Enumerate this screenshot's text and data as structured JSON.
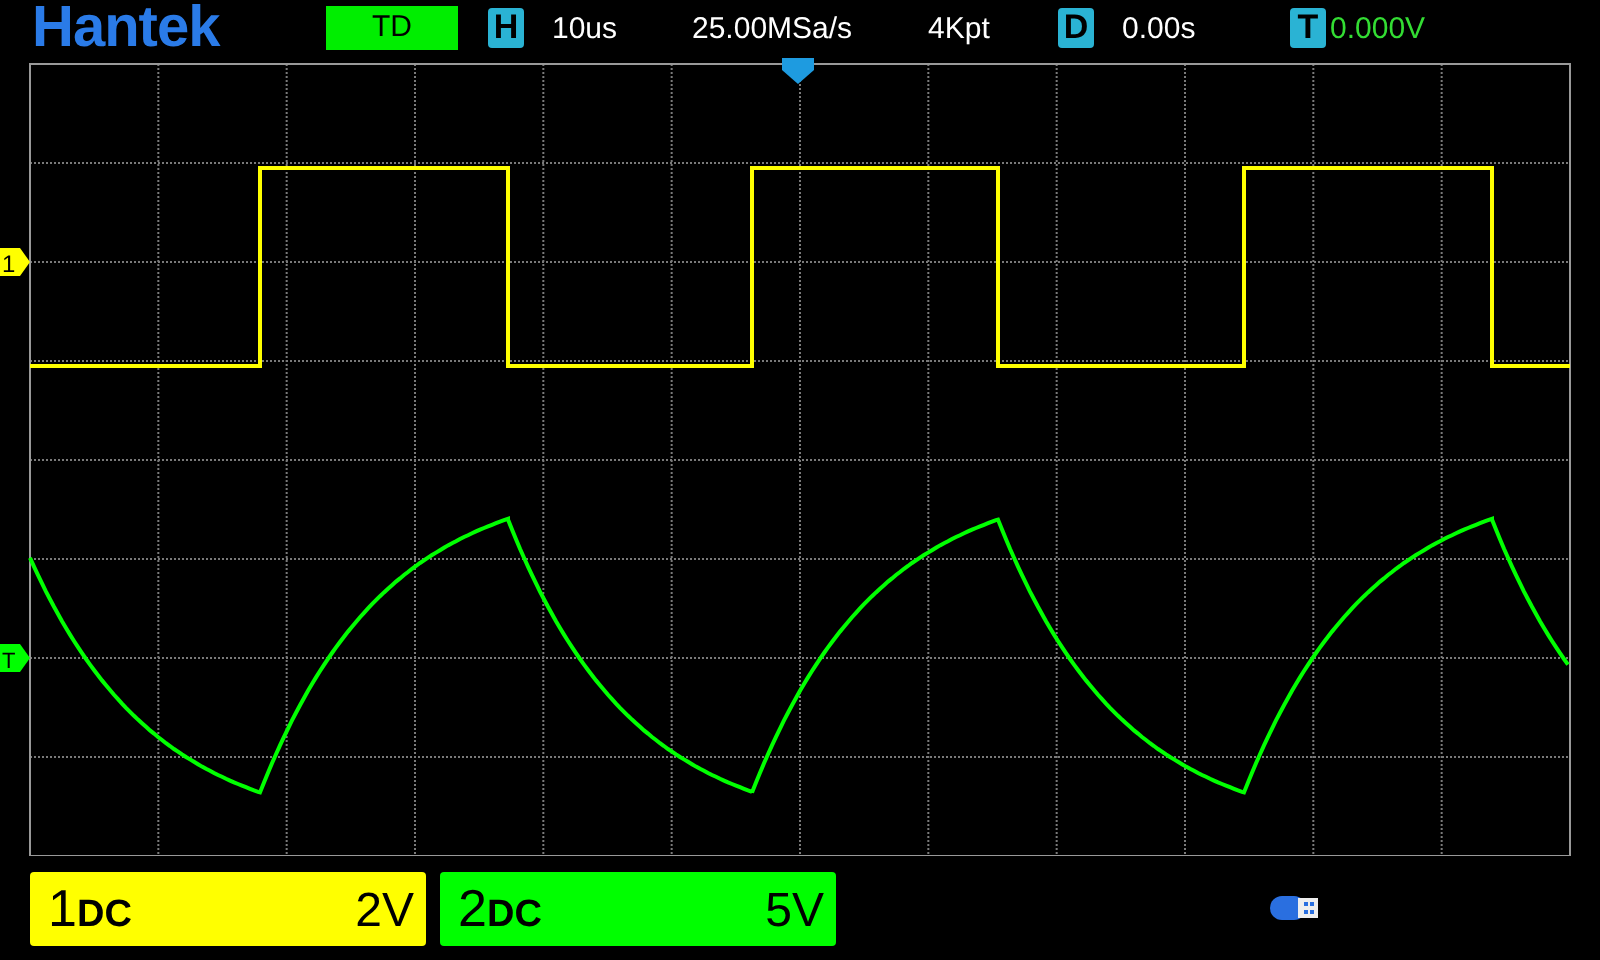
{
  "header": {
    "logo": "Hantek",
    "mode": "TD",
    "timebase": {
      "icon": "H",
      "value": "10us"
    },
    "sample_rate": "25.00MSa/s",
    "memory_depth": "4Kpt",
    "delay": {
      "icon": "D",
      "value": "0.00s"
    },
    "trigger": {
      "icon": "T",
      "value": "0.000V"
    }
  },
  "screen": {
    "channel_marker": "1",
    "trigger_marker": "T"
  },
  "channels": [
    {
      "number": "1",
      "coupling": "DC",
      "scale": "2V",
      "color": "#ffff00"
    },
    {
      "number": "2",
      "coupling": "DC",
      "scale": "5V",
      "color": "#00ff00"
    }
  ]
}
